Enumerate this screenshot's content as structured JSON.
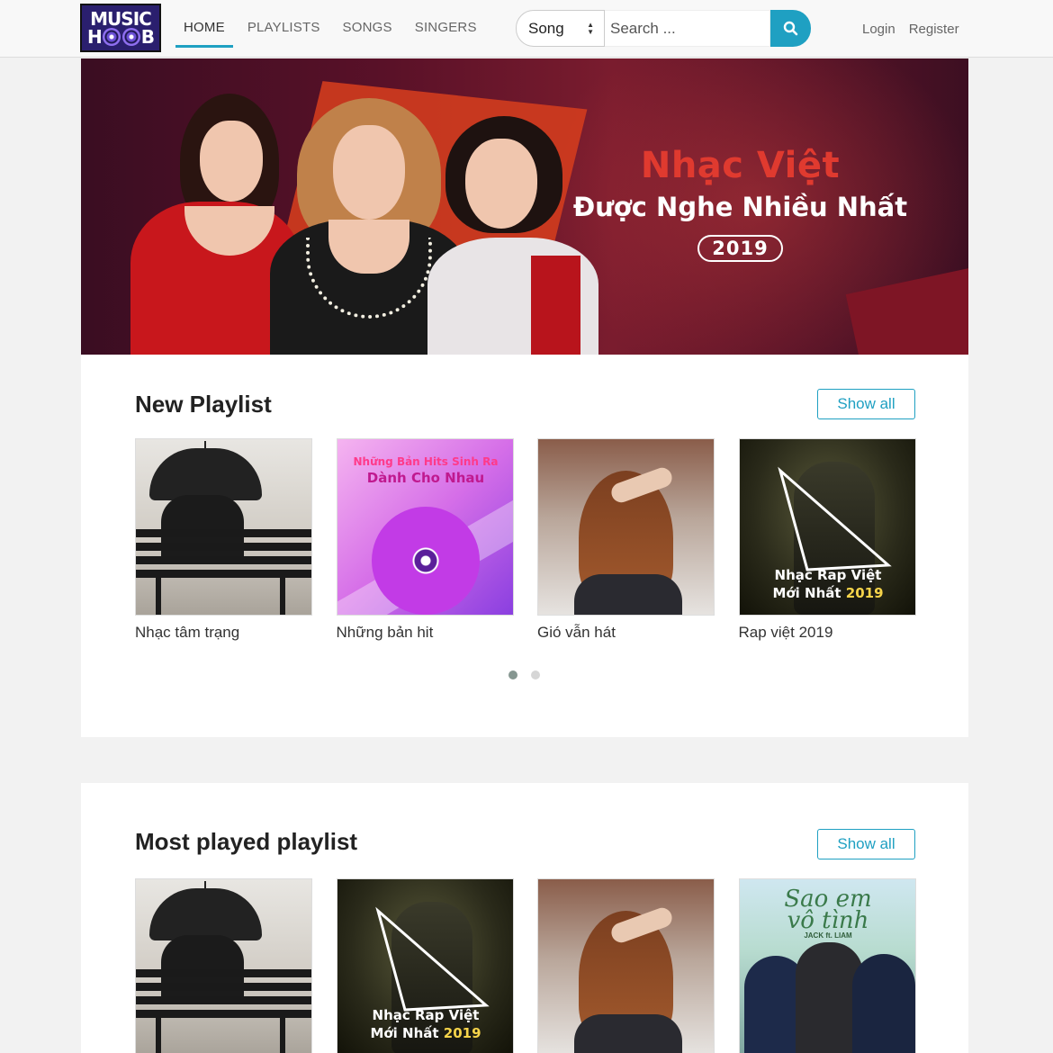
{
  "header": {
    "logo_top": "MUSIC",
    "logo_bottom_left": "H",
    "logo_bottom_right": "B",
    "nav": [
      {
        "label": "HOME",
        "active": true
      },
      {
        "label": "PLAYLISTS",
        "active": false
      },
      {
        "label": "SONGS",
        "active": false
      },
      {
        "label": "SINGERS",
        "active": false
      }
    ],
    "search": {
      "type_selected": "Song",
      "placeholder": "Search ...",
      "button_icon": "search-icon"
    },
    "auth": {
      "login": "Login",
      "register": "Register"
    }
  },
  "banner": {
    "line1": "Nhạc Việt",
    "line2": "Được Nghe Nhiều Nhất",
    "year": "2019"
  },
  "sections": [
    {
      "title": "New Playlist",
      "show_all": "Show all",
      "playlists": [
        {
          "title": "Nhạc tâm trạng"
        },
        {
          "title": "Những bản hit",
          "cover_line1": "Những Bản Hits Sinh Ra",
          "cover_line2": "Dành Cho Nhau"
        },
        {
          "title": "Gió vẫn hát"
        },
        {
          "title": "Rap việt 2019",
          "cover_line1": "Nhạc Rap Việt",
          "cover_line2": "Mới Nhất",
          "cover_year": "2019"
        }
      ],
      "carousel": {
        "pages": 2,
        "current": 1
      }
    },
    {
      "title": "Most played playlist",
      "show_all": "Show all",
      "covers": [
        {},
        {
          "cover_line1": "Nhạc Rap Việt",
          "cover_line2": "Mới Nhất",
          "cover_year": "2019"
        },
        {},
        {
          "cover_line1": "Sao em",
          "cover_line2": "vô tình",
          "cover_line3": "JACK ft. LIAM"
        }
      ]
    }
  ],
  "colors": {
    "accent": "#1fa0c2",
    "banner_red": "#e03a2f",
    "background": "#f2f2f2"
  }
}
